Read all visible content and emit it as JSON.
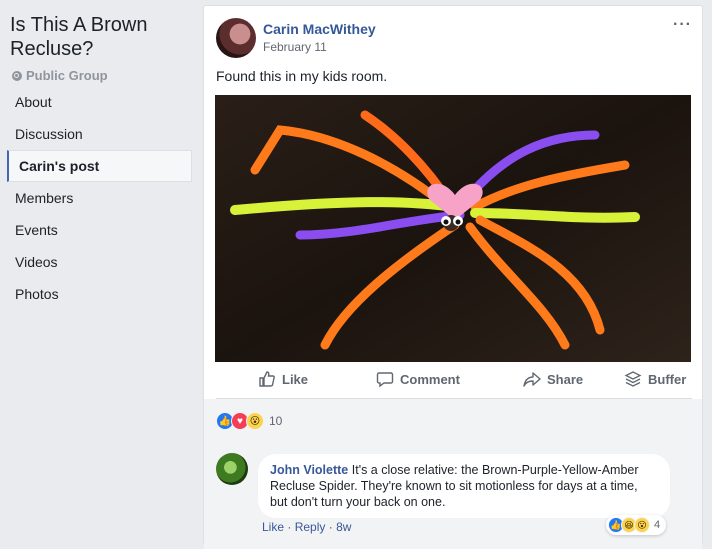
{
  "sidebar": {
    "group_title": "Is This A Brown Recluse?",
    "group_type": "Public Group",
    "items": [
      {
        "label": "About"
      },
      {
        "label": "Discussion"
      },
      {
        "label": "Carin's post",
        "active": true
      },
      {
        "label": "Members"
      },
      {
        "label": "Events"
      },
      {
        "label": "Videos"
      },
      {
        "label": "Photos"
      }
    ]
  },
  "post": {
    "author": "Carin MacWithey",
    "date": "February 11",
    "text": "Found this in my kids room.",
    "more_icon": "ellipsis-icon",
    "actions": [
      {
        "label": "Like",
        "icon": "thumbs-up-icon"
      },
      {
        "label": "Comment",
        "icon": "comment-icon"
      },
      {
        "label": "Share",
        "icon": "share-arrow-icon"
      },
      {
        "label": "Buffer",
        "icon": "buffer-stack-icon"
      }
    ],
    "reactions": {
      "count": "10",
      "types": [
        "like",
        "love",
        "wow"
      ]
    }
  },
  "comment": {
    "author": "John Violette",
    "text": "It's a close relative: the Brown-Purple-Yellow-Amber Recluse Spider. They're known to sit motionless for days at a time, but don't turn your back on one.",
    "like_label": "Like",
    "reply_label": "Reply",
    "separator": "·",
    "time": "8w",
    "reactions": {
      "count": "4",
      "types": [
        "like",
        "haha",
        "wow"
      ]
    }
  },
  "colors": {
    "link_blue": "#365899",
    "page_bg": "#e9ebee",
    "active_border": "#4267b2"
  }
}
